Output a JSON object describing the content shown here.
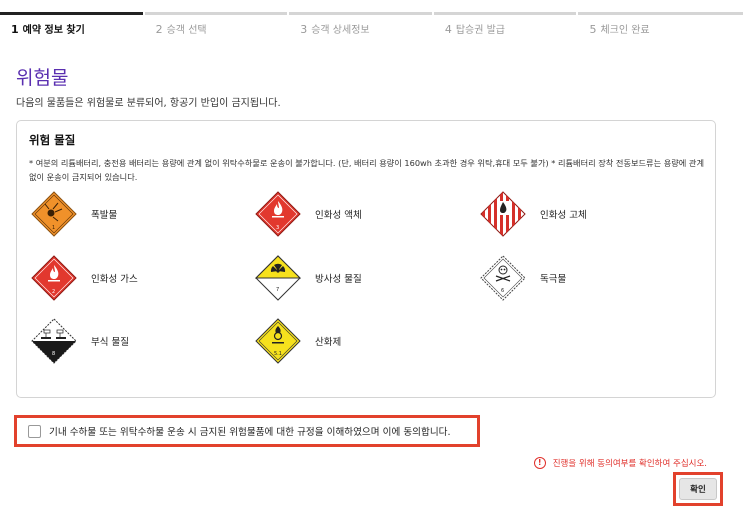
{
  "steps": [
    {
      "num": "1",
      "label": "예약 정보 찾기"
    },
    {
      "num": "2",
      "label": "승객 선택"
    },
    {
      "num": "3",
      "label": "승객 상세정보"
    },
    {
      "num": "4",
      "label": "탑승권 발급"
    },
    {
      "num": "5",
      "label": "체크인 완료"
    }
  ],
  "page": {
    "title": "위험물",
    "description": "다음의 물품들은 위험물로 분류되어, 항공기 반입이 금지됩니다."
  },
  "hazard_box": {
    "title": "위험 물질",
    "notice": "* 여분의 리튬배터리, 충전용 배터리는 용량에 관계 없이 위탁수하물로 운송이 불가합니다. (단, 배터리 용량이 160wh 초과한 경우 위탁,휴대 모두 불가)   * 리튬배터리 장착 전동보드류는 용량에 관계 없이 운송이 금지되어 있습니다.",
    "items": [
      {
        "label": "폭발물",
        "icon": "explosive-icon"
      },
      {
        "label": "인화성 액체",
        "icon": "flammable-liquid-icon"
      },
      {
        "label": "인화성 고체",
        "icon": "flammable-solid-icon"
      },
      {
        "label": "인화성 가스",
        "icon": "flammable-gas-icon"
      },
      {
        "label": "방사성 물질",
        "icon": "radioactive-icon"
      },
      {
        "label": "독극물",
        "icon": "toxic-icon"
      },
      {
        "label": "부식 물질",
        "icon": "corrosive-icon"
      },
      {
        "label": "산화제",
        "icon": "oxidizer-icon"
      }
    ]
  },
  "agreement": {
    "label": "기내 수하물 또는 위탁수하물 운송 시 금지된 위험물품에 대한 규정을 이해하였으며 이에 동의합니다.",
    "checked": false
  },
  "warning": {
    "icon": "!",
    "text": "진행을 위해 동의여부를 확인하여 주십시오."
  },
  "confirm": {
    "label": "확인"
  },
  "colors": {
    "title_accent": "#5a2fb0",
    "highlight_border": "#e2412c",
    "warning": "#e0302b"
  }
}
